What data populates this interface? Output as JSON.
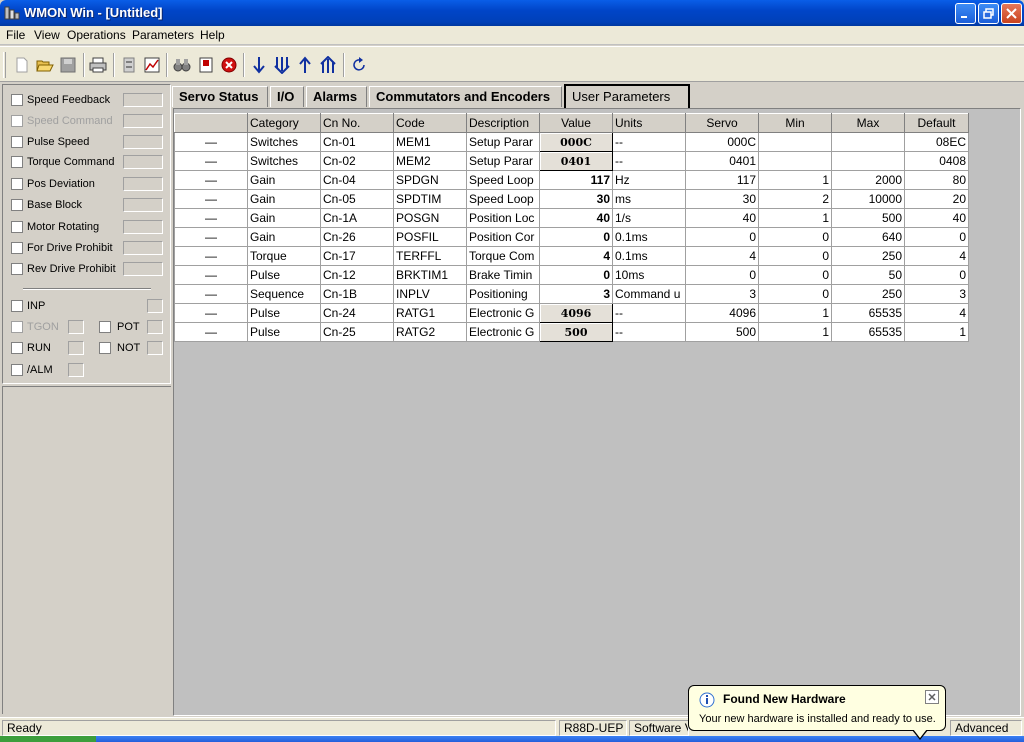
{
  "window": {
    "title": "WMON Win - [Untitled]",
    "colors": {
      "titlebar": "#0045c8",
      "close_button": "#c9431e"
    }
  },
  "menu": [
    "File",
    "View",
    "Operations",
    "Parameters",
    "Help"
  ],
  "toolbar": {
    "icons": [
      "new-icon",
      "open-icon",
      "save-icon",
      "print-icon",
      "monitor-icon",
      "trend-icon",
      "search-icon",
      "flag-icon",
      "stop-icon",
      "download-icon",
      "download-all-icon",
      "upload-icon",
      "upload-all-icon",
      "refresh-icon"
    ]
  },
  "status_panel": {
    "signals": [
      {
        "label": "Speed Feedback",
        "enabled": true
      },
      {
        "label": "Speed Command",
        "enabled": false
      },
      {
        "label": "Pulse Speed",
        "enabled": true
      },
      {
        "label": "Torque Command",
        "enabled": true
      },
      {
        "label": "Pos Deviation",
        "enabled": true
      },
      {
        "label": "Base Block",
        "enabled": true
      },
      {
        "label": "Motor Rotating",
        "enabled": true
      },
      {
        "label": "For Drive Prohibit",
        "enabled": true
      },
      {
        "label": "Rev Drive Prohibit",
        "enabled": true
      }
    ],
    "io": {
      "inp": "INP",
      "tgon": "TGON",
      "pot": "POT",
      "run": "RUN",
      "not": "NOT",
      "alm": "/ALM"
    }
  },
  "tabs": [
    "Servo Status",
    "I/O",
    "Alarms",
    "Commutators and Encoders",
    "User Parameters"
  ],
  "active_tab": "User Parameters",
  "table": {
    "columns": [
      "",
      "Category",
      "Cn No.",
      "Code",
      "Description",
      "Value",
      "Units",
      "Servo",
      "Min",
      "Max",
      "Default"
    ],
    "rows": [
      {
        "mark": "—",
        "category": "Switches",
        "cn": "Cn-01",
        "code": "MEM1",
        "desc": "Setup Parar",
        "value": "000C",
        "units": "--",
        "servo": "000C",
        "min": "",
        "max": "",
        "def": "08EC",
        "edit": true
      },
      {
        "mark": "—",
        "category": "Switches",
        "cn": "Cn-02",
        "code": "MEM2",
        "desc": "Setup Parar",
        "value": "0401",
        "units": "--",
        "servo": "0401",
        "min": "",
        "max": "",
        "def": "0408",
        "edit": true
      },
      {
        "mark": "—",
        "category": "Gain",
        "cn": "Cn-04",
        "code": "SPDGN",
        "desc": "Speed Loop",
        "value": "117",
        "units": "Hz",
        "servo": "117",
        "min": "1",
        "max": "2000",
        "def": "80",
        "edit": false
      },
      {
        "mark": "—",
        "category": "Gain",
        "cn": "Cn-05",
        "code": "SPDTIM",
        "desc": "Speed Loop",
        "value": "30",
        "units": "ms",
        "servo": "30",
        "min": "2",
        "max": "10000",
        "def": "20",
        "edit": false
      },
      {
        "mark": "—",
        "category": "Gain",
        "cn": "Cn-1A",
        "code": "POSGN",
        "desc": "Position Loc",
        "value": "40",
        "units": "1/s",
        "servo": "40",
        "min": "1",
        "max": "500",
        "def": "40",
        "edit": false
      },
      {
        "mark": "—",
        "category": "Gain",
        "cn": "Cn-26",
        "code": "POSFIL",
        "desc": "Position Cor",
        "value": "0",
        "units": "0.1ms",
        "servo": "0",
        "min": "0",
        "max": "640",
        "def": "0",
        "edit": false
      },
      {
        "mark": "—",
        "category": "Torque",
        "cn": "Cn-17",
        "code": "TERFFL",
        "desc": "Torque Com",
        "value": "4",
        "units": "0.1ms",
        "servo": "4",
        "min": "0",
        "max": "250",
        "def": "4",
        "edit": false
      },
      {
        "mark": "—",
        "category": "Pulse",
        "cn": "Cn-12",
        "code": "BRKTIM1",
        "desc": "Brake Timin",
        "value": "0",
        "units": "10ms",
        "servo": "0",
        "min": "0",
        "max": "50",
        "def": "0",
        "edit": false
      },
      {
        "mark": "—",
        "category": "Sequence",
        "cn": "Cn-1B",
        "code": "INPLV",
        "desc": "Positioning",
        "value": "3",
        "units": "Command u",
        "servo": "3",
        "min": "0",
        "max": "250",
        "def": "3",
        "edit": false
      },
      {
        "mark": "—",
        "category": "Pulse",
        "cn": "Cn-24",
        "code": "RATG1",
        "desc": "Electronic G",
        "value": "4096",
        "units": "--",
        "servo": "4096",
        "min": "1",
        "max": "65535",
        "def": "4",
        "edit": true
      },
      {
        "mark": "—",
        "category": "Pulse",
        "cn": "Cn-25",
        "code": "RATG2",
        "desc": "Electronic G",
        "value": "500",
        "units": "--",
        "servo": "500",
        "min": "1",
        "max": "65535",
        "def": "1",
        "edit": true
      }
    ]
  },
  "statusbar": {
    "ready": "Ready",
    "model": "R88D-UEP",
    "software": "Software V",
    "mode": "Advanced"
  },
  "balloon": {
    "title": "Found New Hardware",
    "text": "Your new hardware is installed and ready to use."
  }
}
